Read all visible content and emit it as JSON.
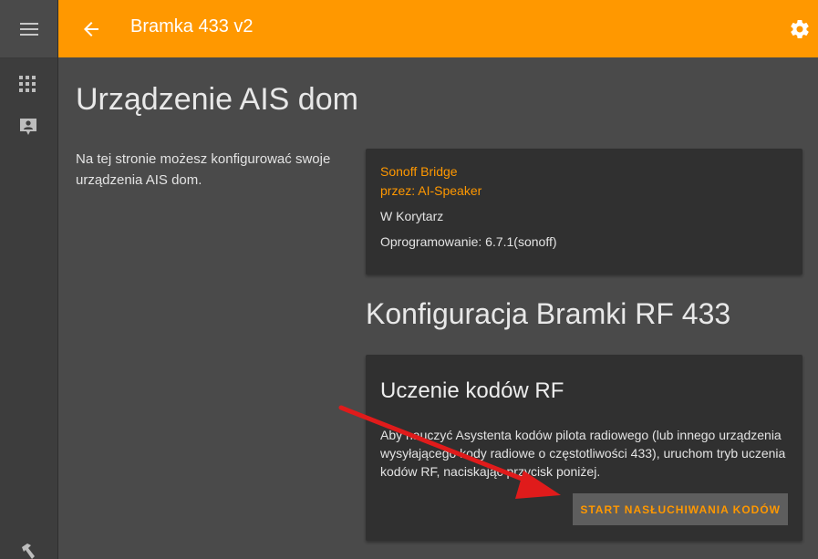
{
  "header": {
    "title": "Bramka 433 v2",
    "back_icon": "arrow-left-icon",
    "settings_icon": "gear-icon",
    "bg_color": "#ff9800"
  },
  "sidebar": {
    "menu_icon": "hamburger-menu-icon",
    "items": [
      {
        "icon": "apps-grid-icon"
      },
      {
        "icon": "contact-card-icon"
      },
      {
        "icon": "hammer-icon"
      }
    ]
  },
  "page": {
    "title": "Urządzenie AIS dom",
    "description": "Na tej stronie możesz konfigurować swoje urządzenia AIS dom."
  },
  "device_card": {
    "model": "Sonoff Bridge",
    "manufacturer": "przez: AI-Speaker",
    "area": "W Korytarz",
    "firmware": "Oprogramowanie: 6.7.1(sonoff)"
  },
  "rf_section": {
    "title": "Konfiguracja Bramki RF 433",
    "card_title": "Uczenie kodów RF",
    "text": "Aby nauczyć Asystenta kodów pilota radiowego (lub innego urządzenia wysyłającego kody radiowe o częstotliwości 433), uruchom tryb uczenia kodów RF, naciskając przycisk poniżej.",
    "button_label": "START NASŁUCHIWANIA KODÓW"
  },
  "colors": {
    "accent": "#ff9800",
    "annotation_arrow": "#e01b1b"
  }
}
